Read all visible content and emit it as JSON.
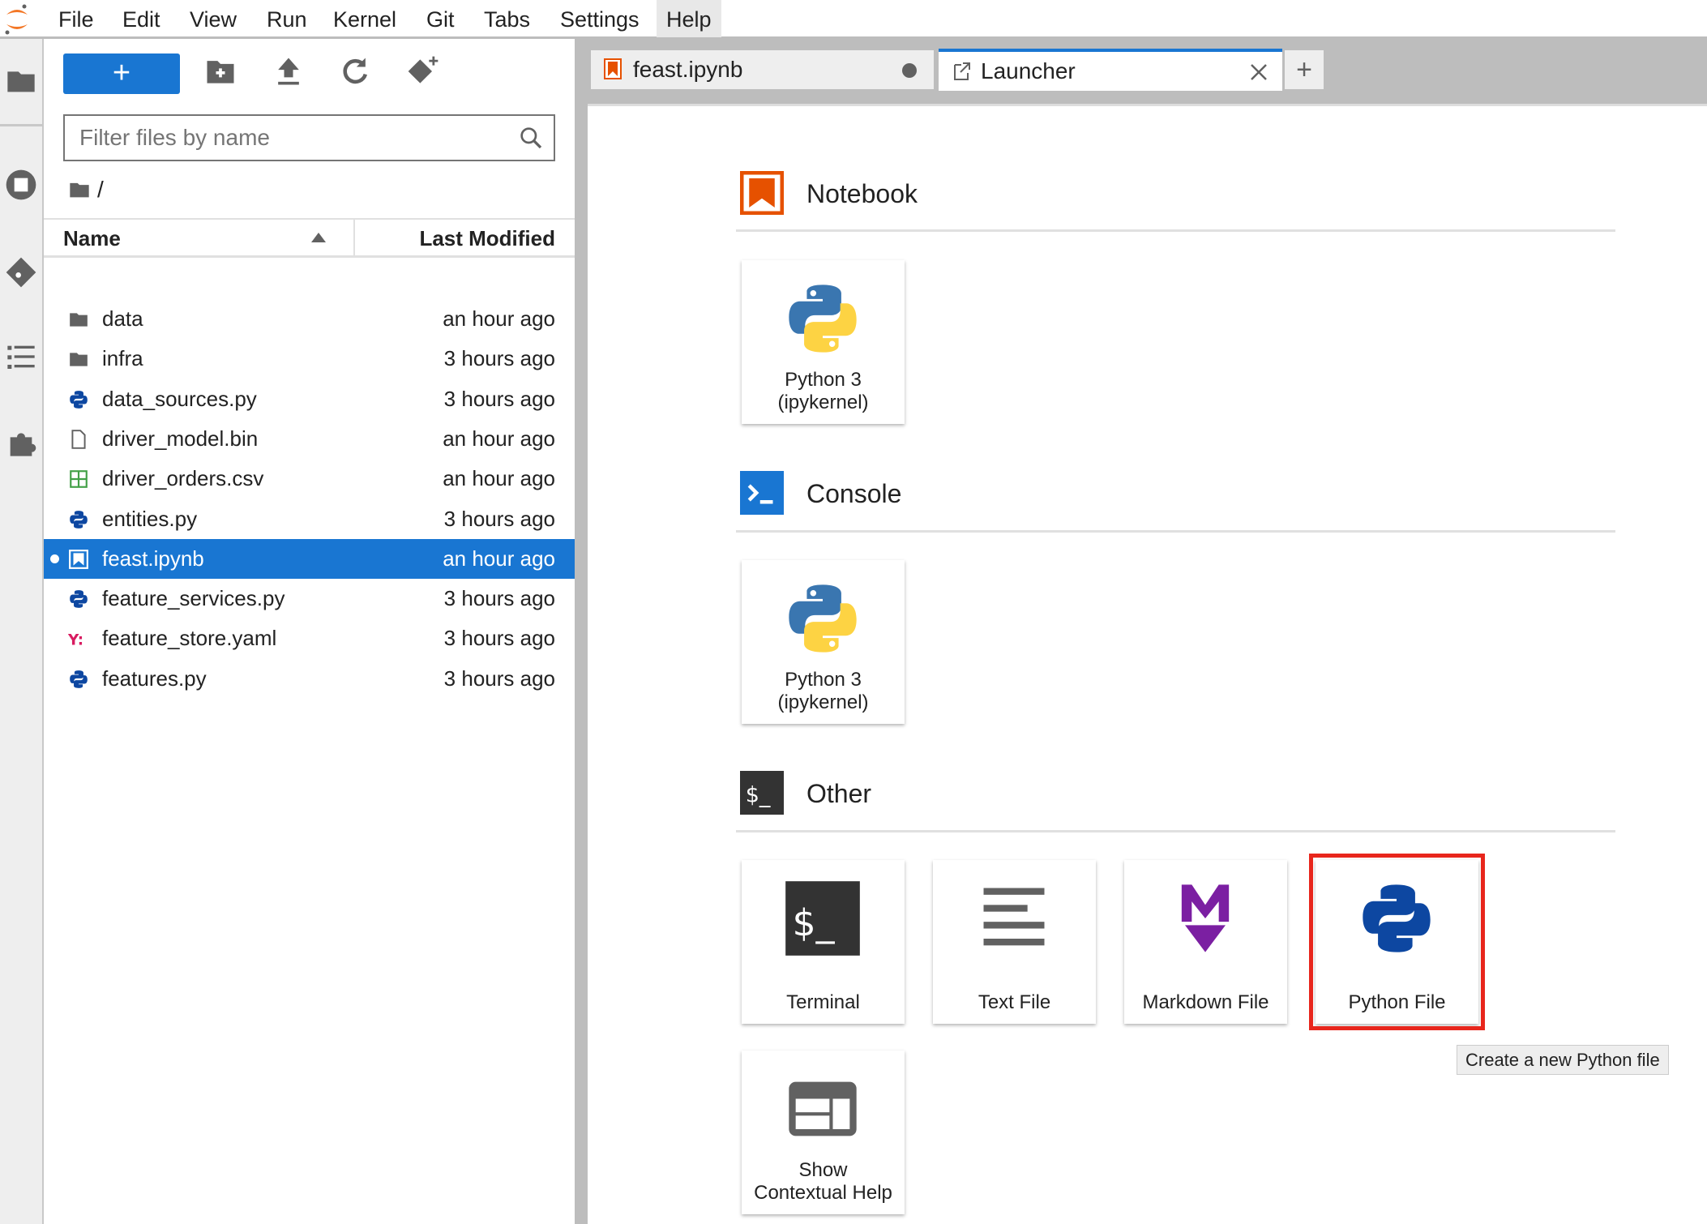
{
  "menu": [
    "File",
    "Edit",
    "View",
    "Run",
    "Kernel",
    "Git",
    "Tabs",
    "Settings",
    "Help"
  ],
  "filebrowser": {
    "new_label": "+",
    "filter_placeholder": "Filter files by name",
    "path": "/",
    "col_name": "Name",
    "col_modified": "Last Modified",
    "files": [
      {
        "name": "data",
        "modified": "an hour ago",
        "type": "folder"
      },
      {
        "name": "infra",
        "modified": "3 hours ago",
        "type": "folder"
      },
      {
        "name": "data_sources.py",
        "modified": "3 hours ago",
        "type": "python"
      },
      {
        "name": "driver_model.bin",
        "modified": "an hour ago",
        "type": "file"
      },
      {
        "name": "driver_orders.csv",
        "modified": "an hour ago",
        "type": "csv"
      },
      {
        "name": "entities.py",
        "modified": "3 hours ago",
        "type": "python"
      },
      {
        "name": "feast.ipynb",
        "modified": "an hour ago",
        "type": "notebook",
        "selected": true
      },
      {
        "name": "feature_services.py",
        "modified": "3 hours ago",
        "type": "python"
      },
      {
        "name": "feature_store.yaml",
        "modified": "3 hours ago",
        "type": "yaml"
      },
      {
        "name": "features.py",
        "modified": "3 hours ago",
        "type": "python"
      }
    ]
  },
  "tabs": [
    {
      "label": "feast.ipynb"
    },
    {
      "label": "Launcher"
    }
  ],
  "launcher": {
    "sections": [
      {
        "title": "Notebook",
        "cards": [
          "Python 3\n(ipykernel)"
        ]
      },
      {
        "title": "Console",
        "cards": [
          "Python 3\n(ipykernel)"
        ]
      },
      {
        "title": "Other",
        "cards": [
          "Terminal",
          "Text File",
          "Markdown File",
          "Python File",
          "Show\nContextual Help"
        ]
      }
    ],
    "tooltip": "Create a new Python file"
  },
  "colors": {
    "accent": "#1976d2",
    "highlight": "#e8261c",
    "notebook": "#e65100"
  }
}
